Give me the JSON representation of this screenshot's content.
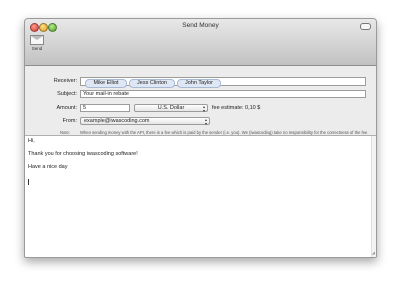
{
  "window": {
    "title": "Send Money"
  },
  "toolbar": {
    "send_label": "Send"
  },
  "form": {
    "receiver_label": "Receiver:",
    "receivers": [
      "Mike Elliot",
      "Jess Clinton",
      "John Taylor"
    ],
    "subject_label": "Subject:",
    "subject_value": "Your mail-in rebate",
    "amount_label": "Amount:",
    "amount_value": "5",
    "currency_value": "U.S. Dollar",
    "fee_estimate": "fee estimate: 0,10 $",
    "from_label": "From:",
    "from_value": "example@iwascoding.com",
    "note_label": "Note:",
    "note_text": "When sending money with the API, there is a fee which is paid by the sender (i.e. you). We (iwascoding) take no responsibility for the correctness of the fee estimate. If in doubt, please contact PayPal."
  },
  "message": {
    "lines": [
      "Hi,",
      "Thank you for choosing iwascoding software!",
      "Have a nice day"
    ]
  }
}
